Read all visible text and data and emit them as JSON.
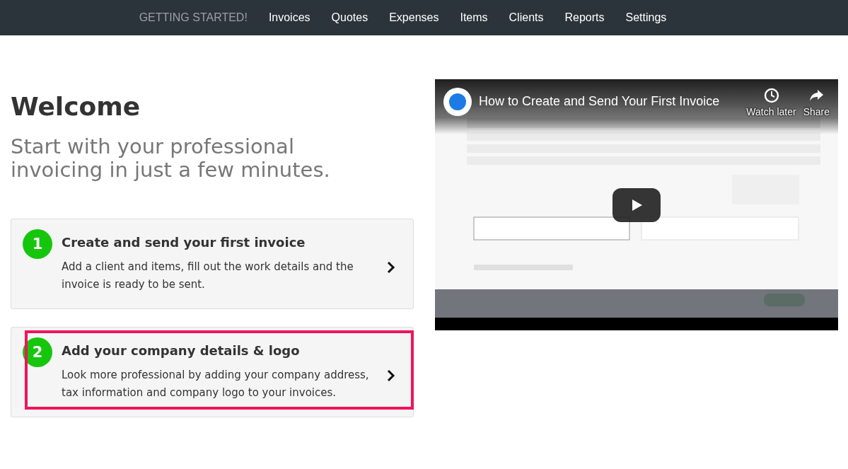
{
  "nav": {
    "items": [
      {
        "label": "GETTING STARTED!",
        "selected": true
      },
      {
        "label": "Invoices",
        "selected": false
      },
      {
        "label": "Quotes",
        "selected": false
      },
      {
        "label": "Expenses",
        "selected": false
      },
      {
        "label": "Items",
        "selected": false
      },
      {
        "label": "Clients",
        "selected": false
      },
      {
        "label": "Reports",
        "selected": false
      },
      {
        "label": "Settings",
        "selected": false
      }
    ]
  },
  "heading": "Welcome",
  "subtitle": "Start with your professional invoicing in just a few minutes.",
  "steps": [
    {
      "number": "1",
      "title": "Create and send your first invoice",
      "text": "Add a client and items, fill out the work details and the invoice is ready to be sent.",
      "highlighted": false
    },
    {
      "number": "2",
      "title": "Add your company details & logo",
      "text": "Look more professional by adding your company address, tax information and company logo to your invoices.",
      "highlighted": true
    }
  ],
  "video": {
    "title": "How to Create and Send Your First Invoice",
    "actions": [
      "Watch later",
      "Share"
    ]
  }
}
